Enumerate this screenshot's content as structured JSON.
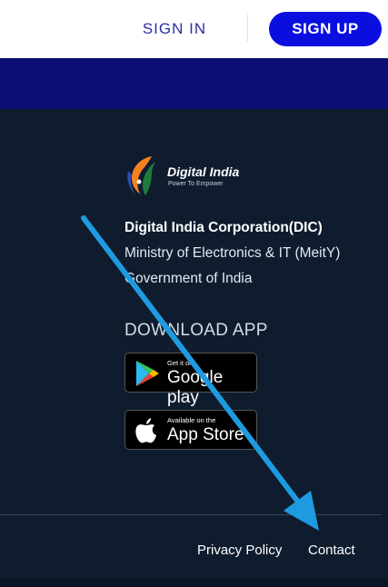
{
  "header": {
    "signin_label": "SIGN IN",
    "signup_label": "SIGN UP"
  },
  "logo": {
    "title": "Digital India",
    "tagline": "Power To Empower"
  },
  "org": {
    "line1": "Digital India Corporation(DIC)",
    "line2": "Ministry of Electronics & IT (MeitY)",
    "line3": "Government of India"
  },
  "download": {
    "heading": "DOWNLOAD APP",
    "google_small": "Get it on",
    "google_big": "Google play",
    "apple_small": "Available on the",
    "apple_big": "App Store"
  },
  "footer_links": {
    "privacy": "Privacy Policy",
    "contact": "Contact"
  },
  "colors": {
    "accent": "#0a0fe0",
    "band": "#0b0f74",
    "footer_bg": "#0f1c2e",
    "annotation_arrow": "#1e9be0"
  }
}
